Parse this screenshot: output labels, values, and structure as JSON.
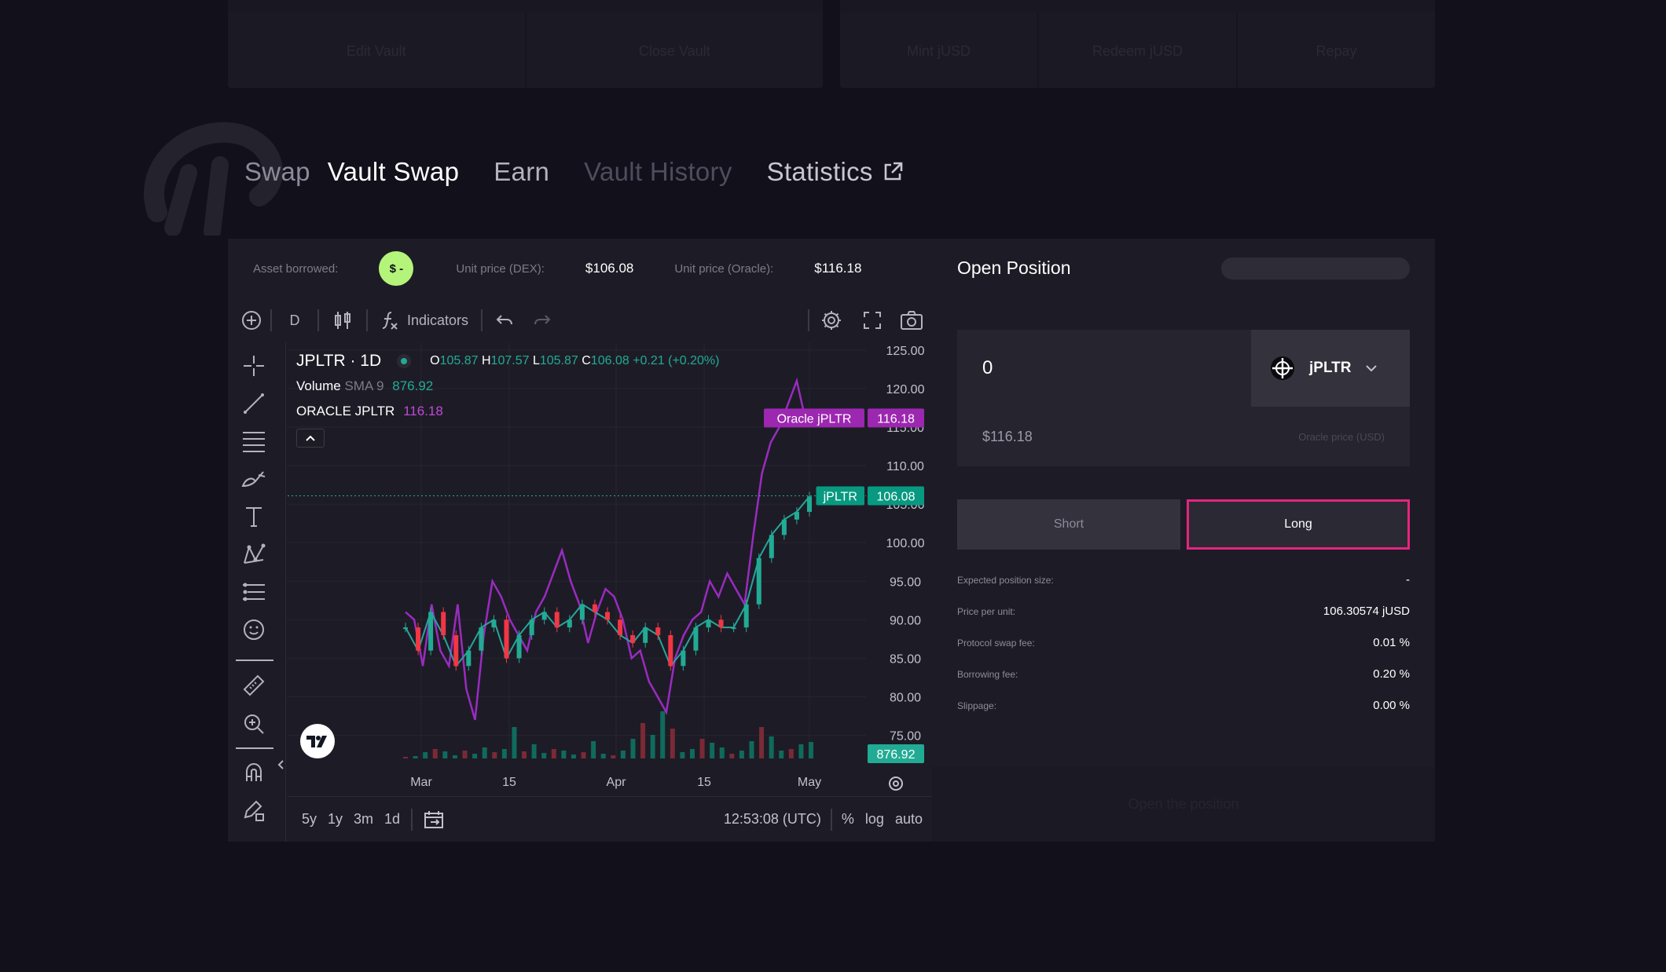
{
  "top_cards": {
    "left": [
      "Edit Vault",
      "Close Vault"
    ],
    "right": [
      "Mint jUSD",
      "Redeem jUSD",
      "Repay"
    ]
  },
  "tabs": [
    {
      "label": "Swap"
    },
    {
      "label": "Vault Swap"
    },
    {
      "label": "Earn"
    },
    {
      "label": "Vault History"
    },
    {
      "label": "Statistics"
    }
  ],
  "stats": {
    "asset_borrowed_label": "Asset borrowed:",
    "asset_badge": "$ -",
    "dex_label": "Unit price (DEX):",
    "dex_value": "$106.08",
    "oracle_label": "Unit price (Oracle):",
    "oracle_value": "$116.18"
  },
  "toolbar": {
    "interval": "D",
    "indicators": "Indicators"
  },
  "legend": {
    "symbol": "JPLTR · 1D",
    "o_label": "O",
    "o": "105.87",
    "h_label": "H",
    "h": "107.57",
    "l_label": "L",
    "l": "105.87",
    "c_label": "C",
    "c": "106.08",
    "change": "+0.21 (+0.20%)",
    "volume_label": "Volume",
    "sma_label": "SMA 9",
    "sma_value": "876.92",
    "oracle_label": "ORACLE JPLTR",
    "oracle_value": "116.18"
  },
  "chart_data": {
    "type": "line",
    "x_labels": [
      "Mar",
      "15",
      "Apr",
      "15",
      "May"
    ],
    "y_ticks": [
      "125.00",
      "120.00",
      "115.00",
      "110.00",
      "105.00",
      "100.00",
      "95.00",
      "90.00",
      "85.00",
      "80.00",
      "75.00"
    ],
    "ylim": [
      72,
      126
    ],
    "series": [
      {
        "name": "Oracle jPLTR",
        "color": "#9a2bc0",
        "values": [
          91,
          90,
          84,
          92,
          86,
          84,
          92,
          81,
          77,
          88,
          95,
          93,
          90,
          88,
          86,
          91,
          93,
          96,
          99,
          95,
          92,
          87,
          91,
          94,
          93,
          90,
          85,
          86,
          82,
          80,
          78,
          85,
          88,
          90,
          91,
          95,
          93,
          96,
          94,
          92,
          101,
          109,
          113,
          115,
          118,
          121,
          116,
          116
        ]
      },
      {
        "name": "jPLTR",
        "color": "#26a69a",
        "values": [
          89,
          86,
          91,
          88,
          84,
          86,
          89,
          90,
          85,
          88,
          90,
          91,
          89,
          90,
          92,
          91,
          90,
          88,
          87,
          89,
          88,
          84,
          86,
          89,
          90,
          89,
          89,
          92,
          98,
          101,
          103,
          104,
          106
        ]
      }
    ],
    "price_tags": [
      {
        "label": "Oracle jPLTR",
        "value": "116.18",
        "color": "#9c27b0"
      },
      {
        "label": "jPLTR",
        "value": "106.08",
        "color": "#089981"
      }
    ],
    "volume_tag": "876.92",
    "volume_values": [
      2,
      3,
      8,
      12,
      9,
      4,
      10,
      6,
      14,
      8,
      12,
      40,
      9,
      18,
      7,
      12,
      10,
      5,
      8,
      22,
      6,
      4,
      10,
      25,
      45,
      30,
      60,
      38,
      8,
      12,
      25,
      20,
      14,
      6,
      10,
      22,
      40,
      28,
      10,
      12,
      18,
      21
    ]
  },
  "timebar": {
    "ranges": [
      "5y",
      "1y",
      "3m",
      "1d"
    ],
    "time": "12:53:08 (UTC)",
    "pct": "%",
    "log": "log",
    "auto": "auto"
  },
  "order": {
    "title": "Open Position",
    "amount": "0",
    "token": "jPLTR",
    "oracle_value": "$116.18",
    "oracle_label": "Oracle price (USD)",
    "short_label": "Short",
    "long_label": "Long",
    "rows": [
      {
        "k": "Expected position size:",
        "v": "-"
      },
      {
        "k": "Price per unit:",
        "v": "106.30574 jUSD"
      },
      {
        "k": "Protocol swap fee:",
        "v": "0.01 %"
      },
      {
        "k": "Borrowing fee:",
        "v": "0.20 %"
      },
      {
        "k": "Slippage:",
        "v": "0.00 %"
      }
    ],
    "open_button": "Open the position"
  }
}
